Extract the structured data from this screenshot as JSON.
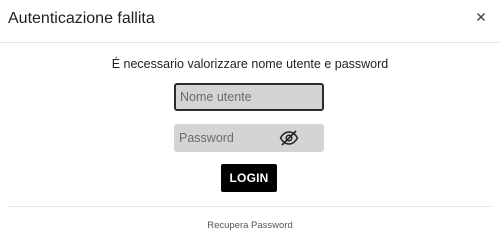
{
  "dialog": {
    "title": "Autenticazione fallita",
    "close_icon": "close-icon"
  },
  "form": {
    "message": "É necessario valorizzare nome utente e password",
    "username": {
      "placeholder": "Nome utente",
      "value": ""
    },
    "password": {
      "placeholder": "Password",
      "value": "",
      "toggle_icon": "eye-slash-icon"
    },
    "login_label": "LOGIN"
  },
  "footer": {
    "recover_label": "Recupera Password"
  },
  "colors": {
    "input_background": "#d4d4d4",
    "button_background": "#000000",
    "button_text": "#ffffff",
    "focused_border": "#2b2b2b"
  }
}
